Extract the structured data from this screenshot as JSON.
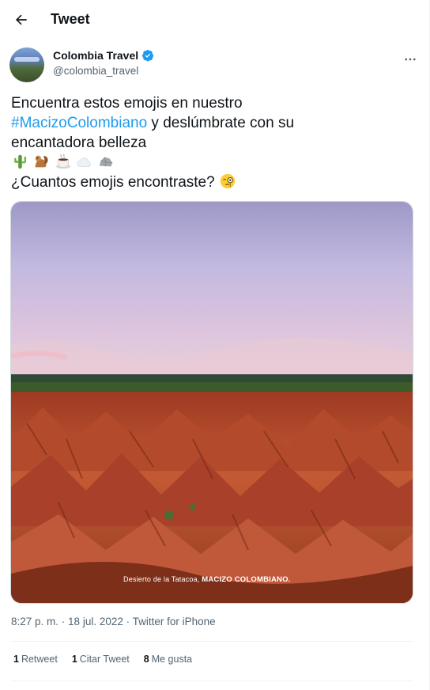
{
  "header": {
    "title": "Tweet",
    "back_icon": "arrow-left-icon"
  },
  "author": {
    "name": "Colombia Travel",
    "handle": "@colombia_travel",
    "verified": true,
    "verified_color": "#1d9bf0",
    "more_icon": "more-horizontal-icon"
  },
  "tweet": {
    "line1": "Encuentra estos emojis en nuestro",
    "hashtag": "#MacizoColombiano",
    "line2_rest": " y deslúmbrate con su",
    "line3": "encantadora belleza",
    "emojis": [
      "cactus-emoji",
      "chipmunk-emoji",
      "hot-beverage-emoji",
      "cloud-emoji",
      "rock-emoji"
    ],
    "line4": "¿Cuantos emojis encontraste? ",
    "trailing_emoji": "face-with-monocle-emoji"
  },
  "media": {
    "caption_prefix": "Desierto de la Tatacoa, ",
    "caption_bold": "MACIZO COLOMBIANO."
  },
  "meta": {
    "time": "8:27 p. m.",
    "separator": " · ",
    "date": "18 jul. 2022",
    "source": "Twitter for iPhone"
  },
  "stats": {
    "retweets_count": "1",
    "retweets_label": "Retweet",
    "quotes_count": "1",
    "quotes_label": "Citar Tweet",
    "likes_count": "8",
    "likes_label": "Me gusta"
  },
  "colors": {
    "accent": "#1d9bf0",
    "text": "#0f1419",
    "secondary": "#536471"
  }
}
